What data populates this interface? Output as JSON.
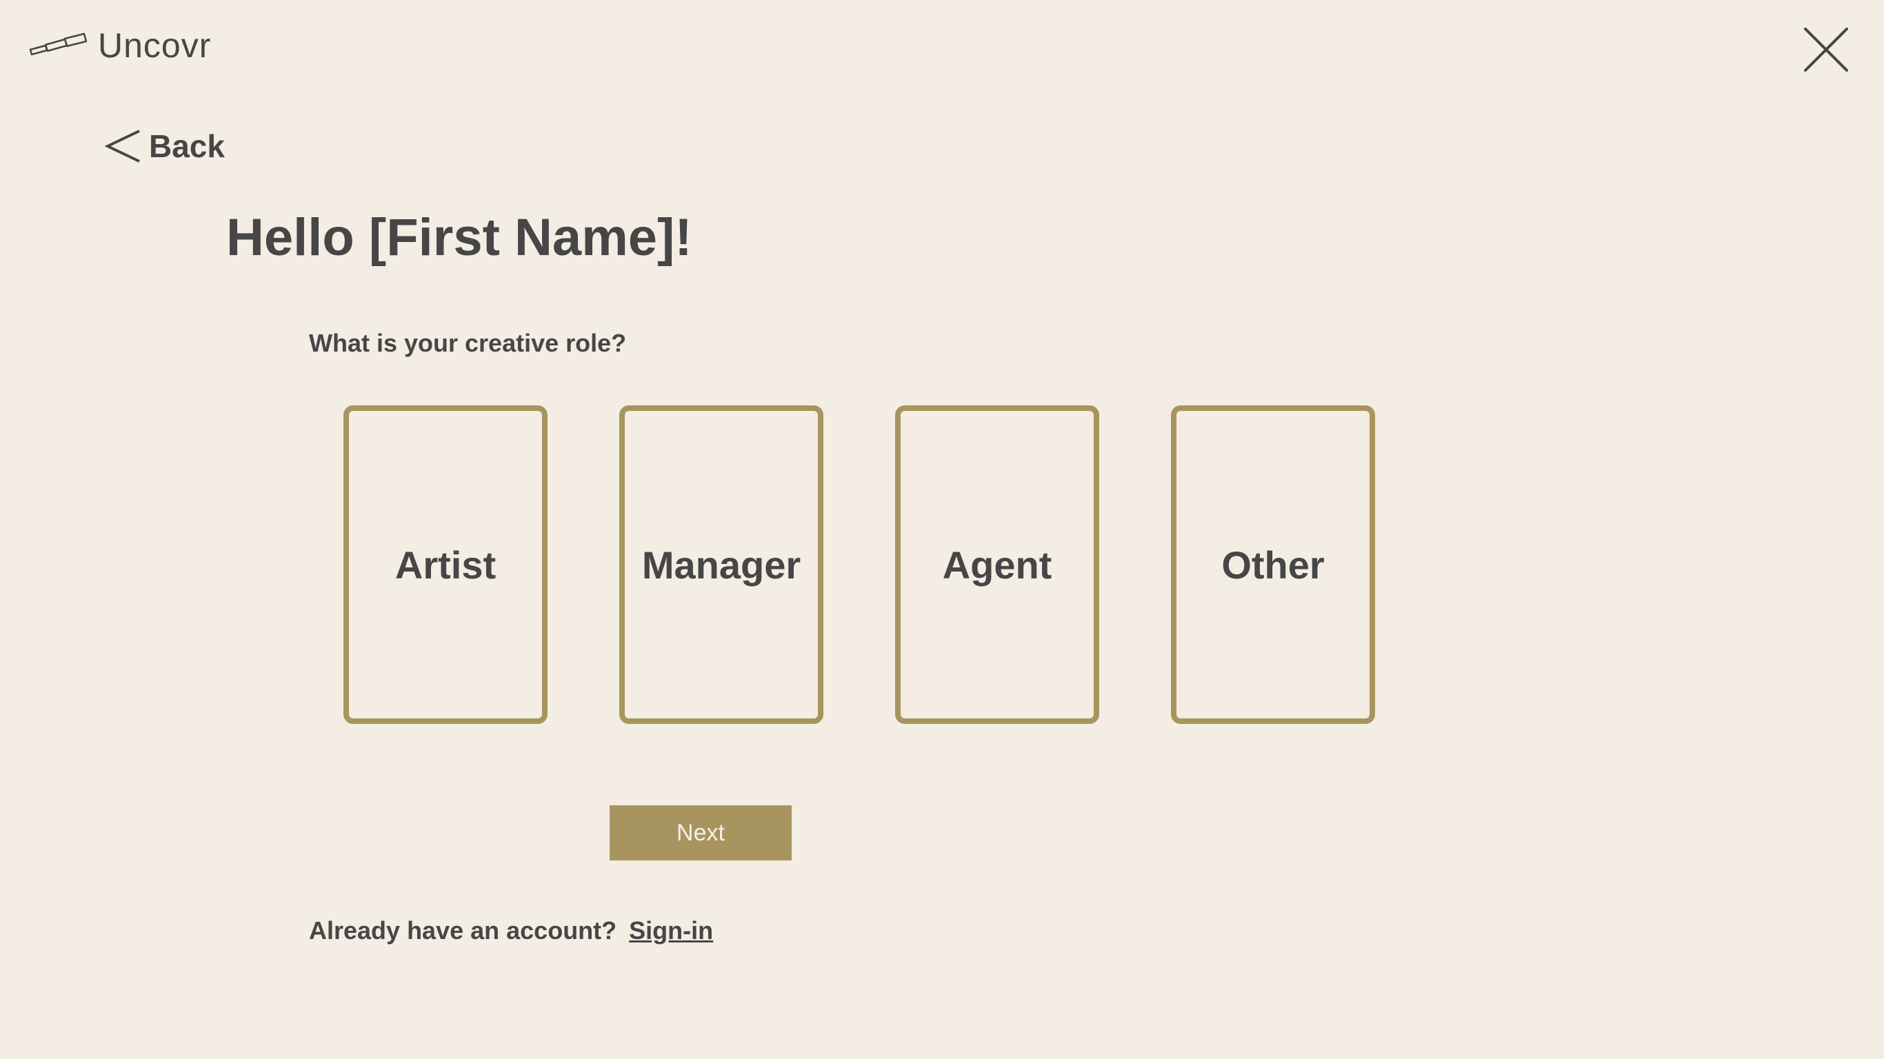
{
  "app": {
    "name": "Uncovr"
  },
  "nav": {
    "back_label": "Back"
  },
  "page": {
    "greeting": "Hello [First Name]!",
    "question": "What is your creative role?"
  },
  "roles": [
    {
      "label": "Artist"
    },
    {
      "label": "Manager"
    },
    {
      "label": "Agent"
    },
    {
      "label": "Other"
    }
  ],
  "actions": {
    "next_label": "Next",
    "account_prompt": "Already have an account?",
    "signin_label": "Sign-in"
  },
  "icons": {
    "logo": "telescope-icon",
    "close": "close-icon",
    "back": "chevron-left-icon"
  },
  "colors": {
    "background": "#f3ede3",
    "accent": "#a8945f",
    "text": "#464646"
  }
}
